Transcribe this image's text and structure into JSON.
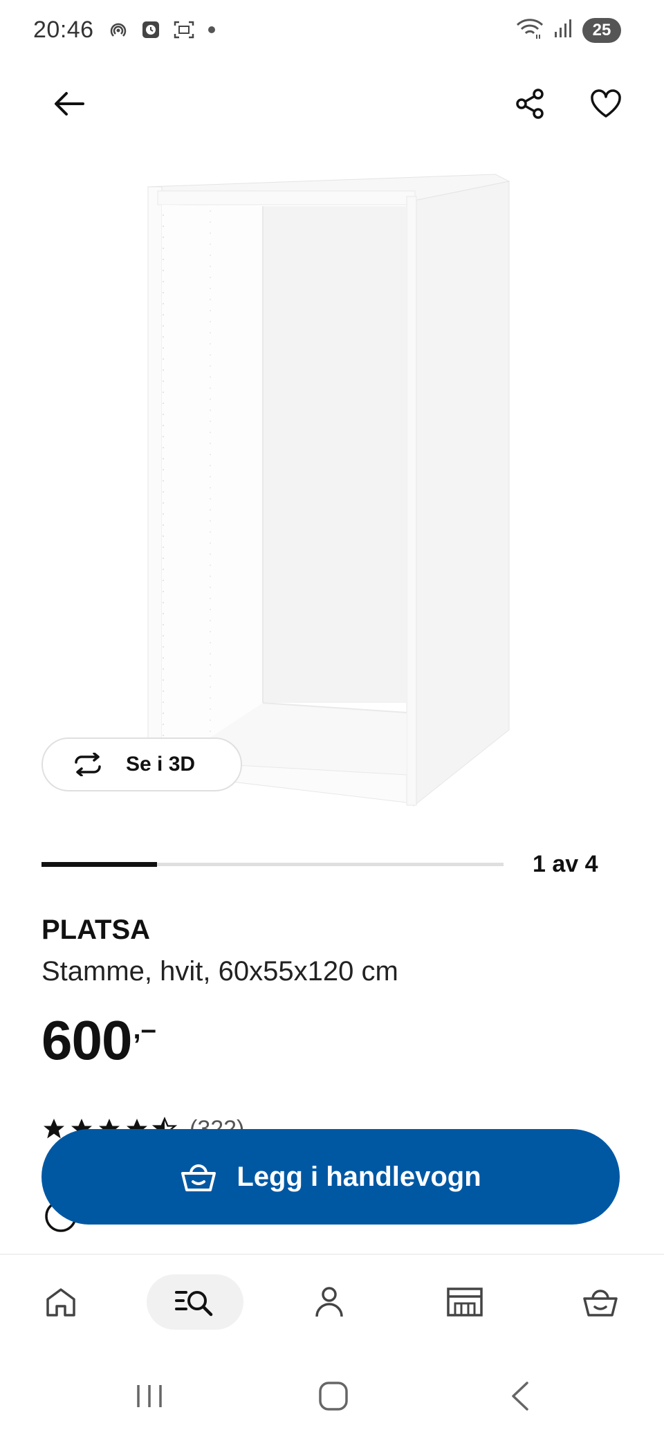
{
  "status_bar": {
    "time": "20:46",
    "battery": "25",
    "icons_left": [
      "hotspot-icon",
      "clock-app-icon",
      "screenshot-icon",
      "dot-icon"
    ],
    "icons_right": [
      "wifi-icon",
      "signal-icon",
      "battery-icon"
    ]
  },
  "top_bar": {
    "icons": [
      "back-arrow-icon",
      "share-icon",
      "heart-icon"
    ]
  },
  "gallery": {
    "view_3d_label": "Se i 3D",
    "pager_text": "1 av 4",
    "current_page": 1,
    "total_pages": 4
  },
  "product": {
    "name": "PLATSA",
    "description": "Stamme, hvit, 60x55x120 cm",
    "price": "600",
    "price_suffix": ",–",
    "rating_stars": 4.5,
    "rating_count": "(322)"
  },
  "cart_button": {
    "label": "Legg i handlevogn",
    "color": "#0058a3"
  },
  "bottom_nav": {
    "items": [
      {
        "name": "home",
        "icon": "home-icon"
      },
      {
        "name": "search",
        "icon": "search-list-icon",
        "active": true
      },
      {
        "name": "profile",
        "icon": "person-icon"
      },
      {
        "name": "store",
        "icon": "store-icon"
      },
      {
        "name": "cart",
        "icon": "basket-icon"
      }
    ]
  },
  "system_nav": [
    "recents-icon",
    "home-circle-icon",
    "back-chevron-icon"
  ]
}
